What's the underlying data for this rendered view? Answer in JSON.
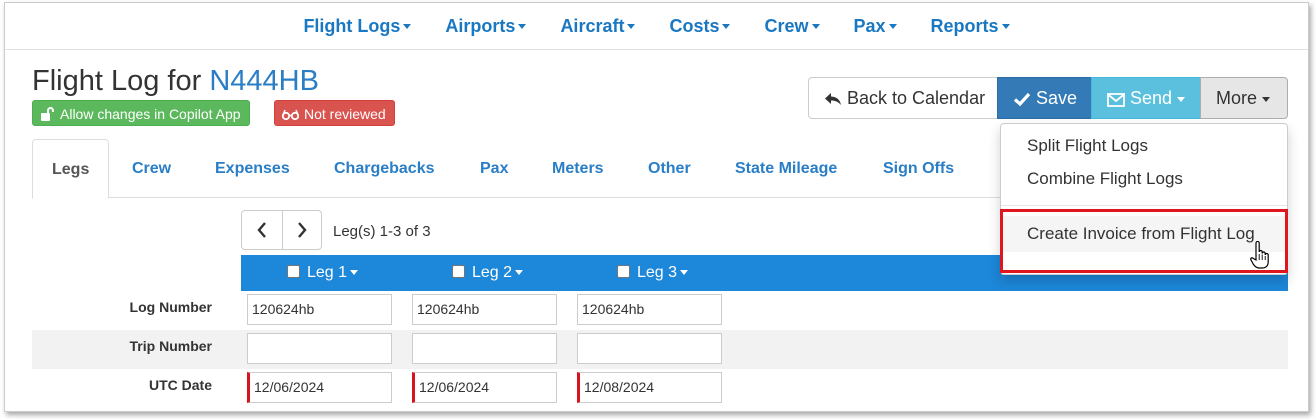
{
  "topnav": [
    {
      "label": "Flight Logs"
    },
    {
      "label": "Airports"
    },
    {
      "label": "Aircraft"
    },
    {
      "label": "Costs"
    },
    {
      "label": "Crew"
    },
    {
      "label": "Pax"
    },
    {
      "label": "Reports"
    }
  ],
  "header": {
    "title_prefix": "Flight Log for ",
    "tail_number": "N444HB",
    "badge_allow": "Allow changes in Copilot App",
    "badge_review": "Not reviewed"
  },
  "toolbar": {
    "back": "Back to Calendar",
    "save": "Save",
    "send": "Send",
    "more": "More"
  },
  "more_menu": {
    "items": [
      "Split Flight Logs",
      "Combine Flight Logs",
      "Create Invoice from Flight Log"
    ]
  },
  "tabs": [
    "Legs",
    "Crew",
    "Expenses",
    "Chargebacks",
    "Pax",
    "Meters",
    "Other",
    "State Mileage",
    "Sign Offs"
  ],
  "pager": {
    "count_text": "Leg(s) 1-3 of 3"
  },
  "legs": [
    "Leg 1",
    "Leg 2",
    "Leg 3"
  ],
  "rows": [
    {
      "label": "Log Number",
      "values": [
        "120624hb",
        "120624hb",
        "120624hb"
      ]
    },
    {
      "label": "Trip Number",
      "values": [
        "",
        "",
        ""
      ]
    },
    {
      "label": "UTC Date",
      "values": [
        "12/06/2024",
        "12/06/2024",
        "12/08/2024"
      ]
    }
  ],
  "colors": {
    "nav_link": "#1a78c2",
    "leg_bar": "#1d87d9",
    "save": "#337ab7",
    "send": "#5bc0de",
    "highlight": "#e0161e"
  }
}
